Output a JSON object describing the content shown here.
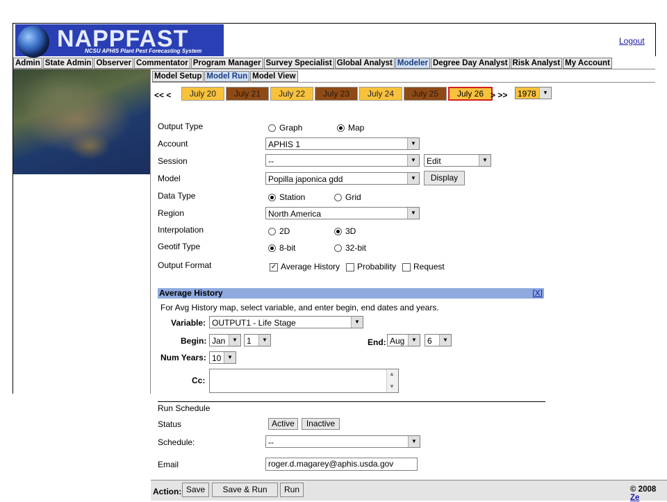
{
  "header": {
    "logo_title": "NAPPFAST",
    "logo_subtitle": "NCSU APHIS Plant Pest Forecasting System",
    "logout": "Logout"
  },
  "top_tabs": [
    "Admin",
    "State Admin",
    "Observer",
    "Commentator",
    "Program Manager",
    "Survey Specialist",
    "Global Analyst",
    "Modeler",
    "Degree Day Analyst",
    "Risk Analyst",
    "My Account"
  ],
  "active_top_tab": "Modeler",
  "sub_tabs": [
    "Model Setup",
    "Model Run",
    "Model View"
  ],
  "active_sub_tab": "Model Run",
  "date_nav": {
    "prev": "<< <",
    "next": "> >>",
    "dates": [
      "July 20",
      "July 21",
      "July 22",
      "July 23",
      "July 24",
      "July 25",
      "July 26"
    ],
    "selected": "July 26",
    "year": "1978"
  },
  "form": {
    "output_type": {
      "label": "Output Type",
      "options": [
        "Graph",
        "Map"
      ],
      "selected": "Map"
    },
    "account": {
      "label": "Account",
      "value": "APHIS 1"
    },
    "session": {
      "label": "Session",
      "value": "--",
      "edit_value": "Edit"
    },
    "model": {
      "label": "Model",
      "value": "Popilla japonica gdd",
      "display_button": "Display"
    },
    "data_type": {
      "label": "Data Type",
      "options": [
        "Station",
        "Grid"
      ],
      "selected": "Station"
    },
    "region": {
      "label": "Region",
      "value": "North America"
    },
    "interpolation": {
      "label": "Interpolation",
      "options": [
        "2D",
        "3D"
      ],
      "selected": "3D"
    },
    "geotif_type": {
      "label": "Geotif Type",
      "options": [
        "8-bit",
        "32-bit"
      ],
      "selected": "8-bit"
    },
    "output_format": {
      "label": "Output Format",
      "options": [
        "Average History",
        "Probability",
        "Request"
      ],
      "checked": [
        "Average History"
      ]
    }
  },
  "avg_history": {
    "title": "Average History",
    "close": "[X]",
    "instructions": "For Avg History map, select variable, and enter begin, end dates and years.",
    "variable_label": "Variable:",
    "variable_value": "OUTPUT1 - Life Stage",
    "begin_label": "Begin:",
    "begin_month": "Jan",
    "begin_day": "1",
    "end_label": "End:",
    "end_month": "Aug",
    "end_day": "6",
    "num_years_label": "Num Years:",
    "num_years": "10",
    "cc_label": "Cc:"
  },
  "schedule": {
    "title": "Run Schedule",
    "status_label": "Status",
    "active_button": "Active",
    "inactive_button": "Inactive",
    "schedule_label": "Schedule:",
    "schedule_value": "--",
    "email_label": "Email",
    "email_value": "roger.d.magarey@aphis.usda.gov"
  },
  "action_bar": {
    "label": "Action:",
    "save": "Save",
    "save_run": "Save & Run",
    "run": "Run",
    "copyright_prefix": "© 2008",
    "copyright_link": "Ze"
  }
}
